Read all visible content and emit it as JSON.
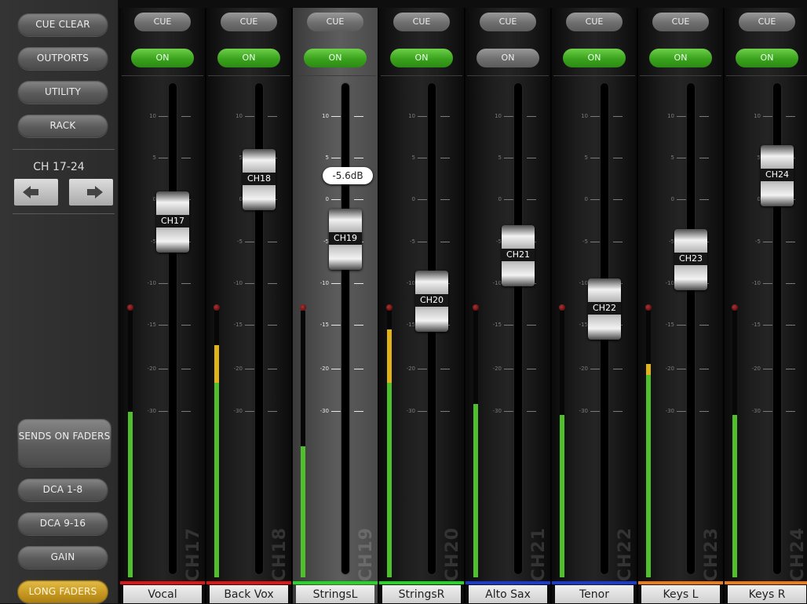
{
  "sidebar": {
    "cue_clear": "CUE CLEAR",
    "outports": "OUTPORTS",
    "utility": "UTILITY",
    "rack": "RACK",
    "bank_label": "CH 17-24",
    "sends_on_faders": "SENDS ON FADERS",
    "dca_1_8": "DCA 1-8",
    "dca_9_16": "DCA 9-16",
    "gain": "GAIN",
    "long_faders": "LONG FADERS"
  },
  "scale_labels": [
    "10",
    "5",
    "0",
    "-5",
    "-10",
    "-15",
    "-20",
    "-30"
  ],
  "selected_tooltip": "-5.6dB",
  "channels": [
    {
      "id": "CH17",
      "name": "Vocal",
      "cue": "CUE",
      "on": "ON",
      "on_state": true,
      "color": "#e01414",
      "selected": false,
      "level_db": -3.5,
      "meter_green": 0.62,
      "meter_yellow": 0
    },
    {
      "id": "CH18",
      "name": "Back Vox",
      "cue": "CUE",
      "on": "ON",
      "on_state": true,
      "color": "#e01414",
      "selected": false,
      "level_db": 1.5,
      "meter_green": 0.73,
      "meter_yellow": 0.14
    },
    {
      "id": "CH19",
      "name": "StringsL",
      "cue": "CUE",
      "on": "ON",
      "on_state": true,
      "color": "#22d822",
      "selected": true,
      "level_db": -5.6,
      "meter_green": 0.49,
      "meter_yellow": 0
    },
    {
      "id": "CH20",
      "name": "StringsR",
      "cue": "CUE",
      "on": "ON",
      "on_state": true,
      "color": "#22d822",
      "selected": false,
      "level_db": -13,
      "meter_green": 0.73,
      "meter_yellow": 0.2
    },
    {
      "id": "CH21",
      "name": "Alto Sax",
      "cue": "CUE",
      "on": "ON",
      "on_state": false,
      "color": "#1a3ad0",
      "selected": false,
      "level_db": -7.5,
      "meter_green": 0.65,
      "meter_yellow": 0
    },
    {
      "id": "CH22",
      "name": "Tenor",
      "cue": "CUE",
      "on": "ON",
      "on_state": true,
      "color": "#1a3ad0",
      "selected": false,
      "level_db": -14,
      "meter_green": 0.61,
      "meter_yellow": 0
    },
    {
      "id": "CH23",
      "name": "Keys L",
      "cue": "CUE",
      "on": "ON",
      "on_state": true,
      "color": "#ee7a1a",
      "selected": false,
      "level_db": -8,
      "meter_green": 0.76,
      "meter_yellow": 0.04
    },
    {
      "id": "CH24",
      "name": "Keys R",
      "cue": "CUE",
      "on": "ON",
      "on_state": true,
      "color": "#ee7a1a",
      "selected": false,
      "level_db": 2,
      "meter_green": 0.61,
      "meter_yellow": 0
    }
  ]
}
